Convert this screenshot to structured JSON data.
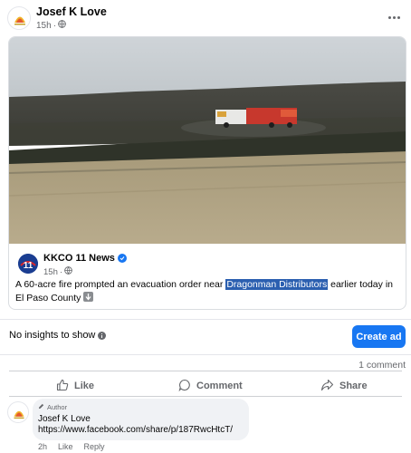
{
  "post": {
    "author": "Josef K Love",
    "time": "15h",
    "audience_icon": "globe-icon"
  },
  "shared": {
    "image_icon": "wildfire-photo",
    "page_name": "KKCO 11 News",
    "page_logo_text": "11",
    "time": "15h",
    "text_before": "A 60-acre fire prompted an evacuation order near ",
    "text_highlight": "Dragonman Distributors",
    "text_after": " earlier today in El Paso County"
  },
  "insights": {
    "text": "No insights to show",
    "create_ad_label": "Create ad"
  },
  "engagement": {
    "comment_count": "1 comment",
    "like_label": "Like",
    "comment_label": "Comment",
    "share_label": "Share"
  },
  "comment": {
    "badge": "Author",
    "author": "Josef K Love",
    "text": "https://www.facebook.com/share/p/187RwcHtcT/",
    "time": "2h",
    "like_label": "Like",
    "reply_label": "Reply"
  },
  "colors": {
    "accent": "#1877f2",
    "highlight": "#2b5fb0",
    "secondary_text": "#65676b"
  }
}
